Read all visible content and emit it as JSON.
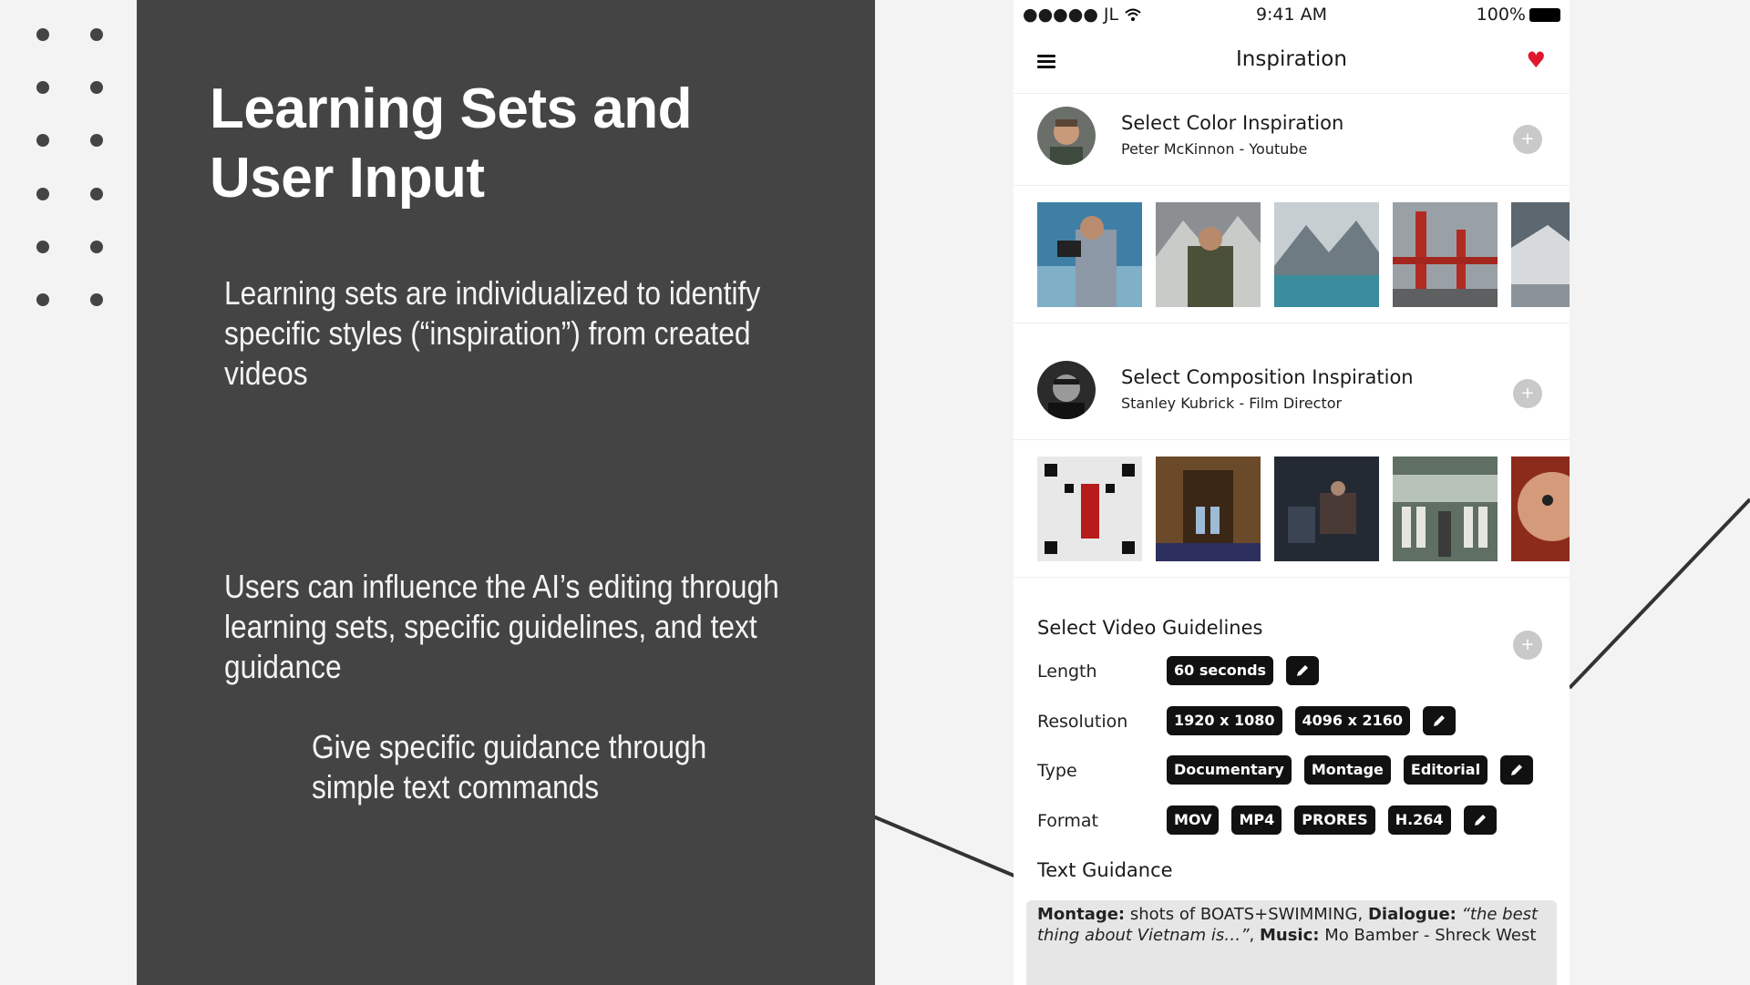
{
  "slide": {
    "title_line1": "Learning Sets and",
    "title_line2": "User Input",
    "para1": "Learning sets are individualized to identify specific styles (“inspiration”)  from created videos",
    "para2": "Users can influence the AI’s editing through learning sets, specific guidelines, and text guidance",
    "para3": "Give specific guidance through simple text commands"
  },
  "phone": {
    "status": {
      "carrier": "●●●●● JL",
      "wifi_icon": "wifi-icon",
      "time": "9:41 AM",
      "battery": "100%"
    },
    "nav": {
      "title": "Inspiration",
      "menu_icon": "hamburger-menu-icon",
      "heart_icon": "heart-icon",
      "heart_color": "#e0182d"
    },
    "inspirations": [
      {
        "title": "Select Color Inspiration",
        "subtitle": "Peter McKinnon - Youtube",
        "add": "+"
      },
      {
        "title": "Select Composition Inspiration",
        "subtitle": "Stanley Kubrick - Film Director",
        "add": "+"
      }
    ],
    "guidelines": {
      "title": "Select Video Guidelines",
      "add": "+",
      "rows": [
        {
          "label": "Length",
          "chips": [
            "60 seconds"
          ]
        },
        {
          "label": "Resolution",
          "chips": [
            "1920 x 1080",
            "4096 x 2160"
          ]
        },
        {
          "label": "Type",
          "chips": [
            "Documentary",
            "Montage",
            "Editorial"
          ]
        },
        {
          "label": "Format",
          "chips": [
            "MOV",
            "MP4",
            "PRORES",
            "H.264"
          ]
        }
      ]
    },
    "text_guidance": {
      "title": "Text Guidance",
      "montage_key": "Montage:",
      "montage_val": " shots of BOATS+SWIMMING, ",
      "dialogue_key": "Dialogue:",
      "dialogue_val": " “the best thing about Vietnam is…”",
      "comma": ", ",
      "music_key": "Music:",
      "music_val": " Mo Bamber - Shreck West"
    }
  }
}
